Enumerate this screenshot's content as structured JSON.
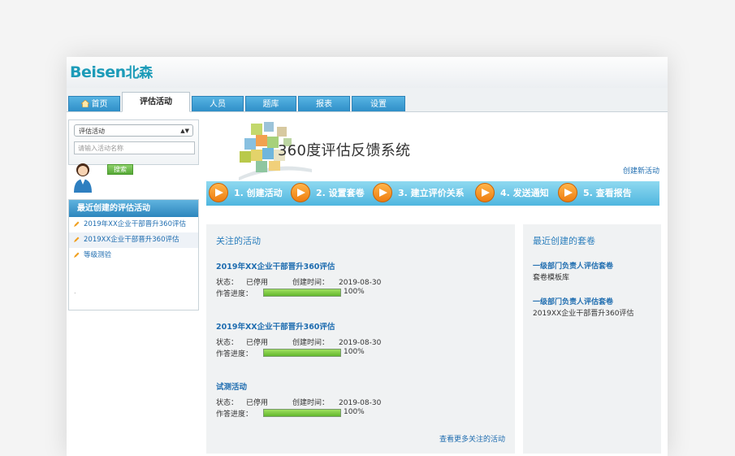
{
  "logo": {
    "text_en": "Beisen",
    "text_cn": "北森"
  },
  "nav": {
    "tabs": [
      {
        "label": "首页"
      },
      {
        "label": "评估活动"
      },
      {
        "label": "人员"
      },
      {
        "label": "题库"
      },
      {
        "label": "报表"
      },
      {
        "label": "设置"
      }
    ]
  },
  "sidebar": {
    "select_value": "评估活动",
    "search_placeholder": "请输入活动名称",
    "search_button": "搜索",
    "recent_title": "最近创建的评估活动",
    "recent_items": [
      {
        "label": "2019年XX企业干部晋升360评估"
      },
      {
        "label": "2019XX企业干部晋升360评估"
      },
      {
        "label": "等级测验"
      }
    ],
    "footer_mark": "."
  },
  "banner": {
    "title": "360度评估反馈系统",
    "create_link": "创建新活动",
    "steps": [
      {
        "label": "1. 创建活动"
      },
      {
        "label": "2. 设置套卷"
      },
      {
        "label": "3. 建立评价关系"
      },
      {
        "label": "4. 发送通知"
      },
      {
        "label": "5. 查看报告"
      }
    ]
  },
  "followed": {
    "title": "关注的活动",
    "status_label": "状态：",
    "created_label": "创建时间：",
    "progress_label": "作答进度：",
    "items": [
      {
        "name": "2019年XX企业干部晋升360评估",
        "status": "已停用",
        "created": "2019-08-30",
        "progress_text": "100%",
        "progress": 1.0
      },
      {
        "name": "2019年XX企业干部晋升360评估",
        "status": "已停用",
        "created": "2019-08-30",
        "progress_text": "100%",
        "progress": 1.0
      },
      {
        "name": "试测活动",
        "status": "已停用",
        "created": "2019-08-30",
        "progress_text": "100%",
        "progress": 1.0
      }
    ],
    "more_link": "查看更多关注的活动"
  },
  "recent_papers": {
    "title": "最近创建的套卷",
    "items": [
      {
        "name": "一级部门负责人评估套卷",
        "sub": "套卷模板库"
      },
      {
        "name": "一级部门负责人评估套卷",
        "sub": "2019XX企业干部晋升360评估"
      }
    ]
  },
  "colors": {
    "accent": "#2f8fc8",
    "link": "#1f6db0",
    "progress": "#63b82d",
    "step_circle": "#ee7d10"
  }
}
